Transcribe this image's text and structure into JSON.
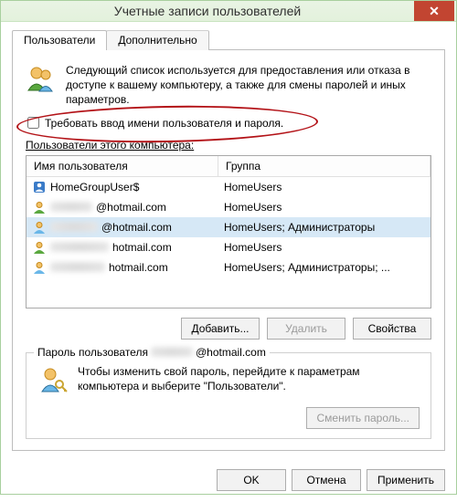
{
  "window": {
    "title": "Учетные записи пользователей"
  },
  "tabs": {
    "users": "Пользователи",
    "advanced": "Дополнительно"
  },
  "intro": "Следующий список используется для предоставления или отказа в доступе к вашему компьютеру, а также для смены паролей и иных параметров.",
  "require_checkbox": "Требовать ввод имени пользователя и пароля.",
  "list_label": "Пользователи этого компьютера:",
  "columns": {
    "name": "Имя пользователя",
    "group": "Группа"
  },
  "users": [
    {
      "name": "HomeGroupUser$",
      "blurred": false,
      "group": "HomeUsers"
    },
    {
      "name": "@hotmail.com",
      "blurred": true,
      "group": "HomeUsers"
    },
    {
      "name": "@hotmail.com",
      "blurred": true,
      "group": "HomeUsers; Администраторы",
      "selected": true
    },
    {
      "name": "hotmail.com",
      "blurred": true,
      "group": "HomeUsers"
    },
    {
      "name": "hotmail.com",
      "blurred": true,
      "group": "HomeUsers; Администраторы; ..."
    }
  ],
  "buttons": {
    "add": "Добавить...",
    "remove": "Удалить",
    "props": "Свойства",
    "changepw": "Сменить пароль...",
    "ok": "OK",
    "cancel": "Отмена",
    "apply": "Применить"
  },
  "pwbox": {
    "legend_prefix": "Пароль пользователя",
    "legend_suffix": "@hotmail.com",
    "text": "Чтобы изменить свой пароль, перейдите к параметрам компьютера и выберите \"Пользователи\"."
  }
}
